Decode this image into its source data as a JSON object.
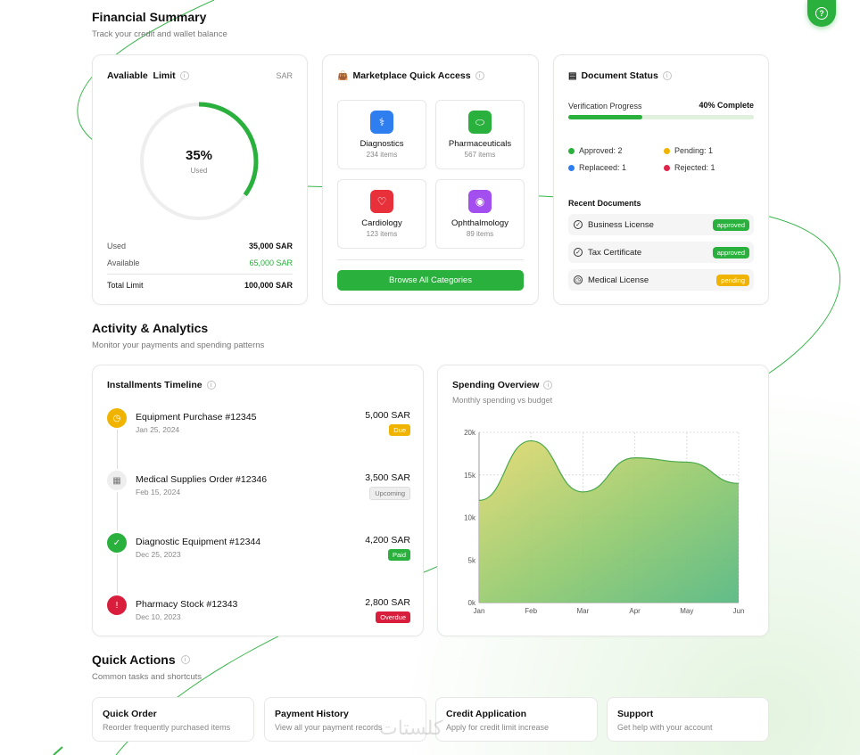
{
  "financial": {
    "title": "Financial Summary",
    "subtitle": "Track your credit and wallet balance"
  },
  "limit_card": {
    "title": "Avaliable  Limit",
    "currency": "SAR",
    "percent_label": "35%",
    "used_fraction": 0.35,
    "percent_sub": "Used",
    "rows": [
      {
        "label": "Used",
        "value": "35,000 SAR"
      },
      {
        "label": "Available",
        "value": "65,000 SAR"
      },
      {
        "label": "Total Limit",
        "value": "100,000 SAR"
      }
    ]
  },
  "marketplace": {
    "title": "Marketplace Quick Access",
    "tiles": [
      {
        "name": "Diagnostics",
        "count": "234 items",
        "color": "#2f7ef0",
        "icon": "stethoscope-icon"
      },
      {
        "name": "Pharmaceuticals",
        "count": "567 items",
        "color": "#2ab03c",
        "icon": "pill-icon"
      },
      {
        "name": "Cardiology",
        "count": "123 items",
        "color": "#e8303a",
        "icon": "heart-icon"
      },
      {
        "name": "Ophthalmology",
        "count": "89 items",
        "color": "#a34ff0",
        "icon": "eye-icon"
      }
    ],
    "browse_label": "Browse All Categories"
  },
  "documents": {
    "title": "Document Status",
    "progress_label": "Verification Progress",
    "progress_value": "40% Complete",
    "progress_fraction": 0.4,
    "legend": [
      {
        "label": "Approved: 2",
        "color": "#2ab03c"
      },
      {
        "label": "Pending: 1",
        "color": "#f0b400"
      },
      {
        "label": "Replaceed: 1",
        "color": "#2f7ef0"
      },
      {
        "label": "Rejected: 1",
        "color": "#e0254a"
      }
    ],
    "recent_title": "Recent Documents",
    "recent": [
      {
        "name": "Business License",
        "status": "approved",
        "color": "#2ab03c",
        "icon": "check-circle-icon"
      },
      {
        "name": "Tax Certificate",
        "status": "approved",
        "color": "#2ab03c",
        "icon": "check-circle-icon"
      },
      {
        "name": "Medical License",
        "status": "pending",
        "color": "#f0b400",
        "icon": "clock-icon"
      }
    ]
  },
  "activity": {
    "title": "Activity & Analytics",
    "subtitle": "Monitor your payments and spending patterns"
  },
  "installments": {
    "title": "Installments Timeline",
    "items": [
      {
        "name": "Equipment Purchase #12345",
        "date": "Jan 25, 2024",
        "amount": "5,000 SAR",
        "status": "Due",
        "color": "#f0b400",
        "badge_text_color": "#ffffff",
        "icon": "clock-icon",
        "icon_glyph": "◷"
      },
      {
        "name": "Medical Supplies Order #12346",
        "date": "Feb 15, 2024",
        "amount": "3,500 SAR",
        "status": "Upcoming",
        "color": "#eeeeee",
        "badge_text_color": "#777777",
        "icon": "calendar-icon",
        "icon_glyph": "▦"
      },
      {
        "name": "Diagnostic Equipment #12344",
        "date": "Dec 25, 2023",
        "amount": "4,200 SAR",
        "status": "Paid",
        "color": "#2ab03c",
        "badge_text_color": "#ffffff",
        "icon": "check-circle-icon",
        "icon_glyph": "✓"
      },
      {
        "name": "Pharmacy Stock #12343",
        "date": "Dec 10, 2023",
        "amount": "2,800 SAR",
        "status": "Overdue",
        "color": "#d81e3c",
        "badge_text_color": "#ffffff",
        "icon": "alert-icon",
        "icon_glyph": "!"
      }
    ]
  },
  "spending": {
    "title": "Spending Overview",
    "subtitle": "Monthly spending vs budget"
  },
  "chart_data": {
    "type": "area",
    "x": [
      "Jan",
      "Feb",
      "Mar",
      "Apr",
      "May",
      "Jun"
    ],
    "series": [
      {
        "values": [
          12000,
          19000,
          13000,
          17000,
          16500,
          14000
        ]
      }
    ],
    "yticks": [
      "0k",
      "5k",
      "10k",
      "15k",
      "20k"
    ],
    "ylim": [
      0,
      20000
    ],
    "grid": true
  },
  "quick_actions": {
    "title": "Quick Actions",
    "subtitle": "Common tasks and shortcuts",
    "items": [
      {
        "title": "Quick Order",
        "sub": "Reorder frequently purchased items"
      },
      {
        "title": "Payment History",
        "sub": "View all your payment records"
      },
      {
        "title": "Credit Application",
        "sub": "Apply for credit limit increase"
      },
      {
        "title": "Support",
        "sub": "Get help with your account"
      }
    ]
  },
  "help": {
    "icon": "help-icon"
  },
  "watermark": "كلستات"
}
